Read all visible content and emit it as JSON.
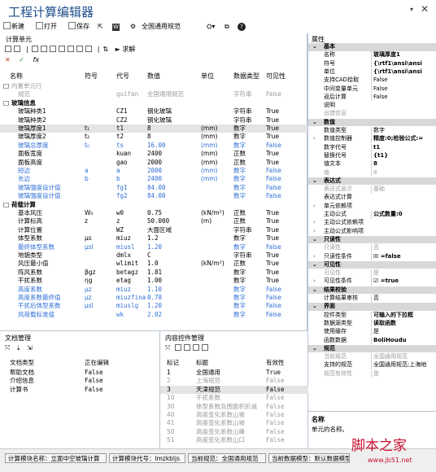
{
  "app": {
    "title": "工程计算编辑器",
    "pin": "▾",
    "close": "✕"
  },
  "toolbar": {
    "new": "新建",
    "open": "打开",
    "save": "保存",
    "word": "W",
    "code_label": "全国通用规范"
  },
  "left_panel": {
    "title": "计算单元",
    "solve": "求解",
    "icons": [
      "✕",
      "✓",
      "fx"
    ]
  },
  "table": {
    "headers": [
      "名称",
      "符号",
      "代号",
      "数值",
      "单位",
      "数据类型",
      "可见性"
    ],
    "rows": [
      {
        "indent": 1,
        "expand": "□",
        "name": "内置单元行",
        "sym": "",
        "code": "",
        "val": "",
        "unit": "",
        "type": "",
        "vis": "",
        "color": "gray"
      },
      {
        "indent": 2,
        "expand": "",
        "name": "规范",
        "sym": "",
        "code": "guifan",
        "val": "全国通用规范",
        "unit": "",
        "type": "字符串",
        "vis": "False",
        "color": "gray"
      },
      {
        "indent": 1,
        "expand": "□",
        "name": "玻璃信息",
        "sym": "",
        "code": "",
        "val": "",
        "unit": "",
        "type": "",
        "vis": "",
        "color": "",
        "group": true
      },
      {
        "indent": 2,
        "expand": "",
        "name": "玻璃种类1",
        "sym": "",
        "code": "CZ1",
        "val": "钢化玻璃",
        "unit": "",
        "type": "字符串",
        "vis": "True",
        "color": ""
      },
      {
        "indent": 2,
        "expand": "",
        "name": "玻璃种类2",
        "sym": "",
        "code": "CZ2",
        "val": "钢化玻璃",
        "unit": "",
        "type": "字符串",
        "vis": "True",
        "color": ""
      },
      {
        "indent": 2,
        "expand": "",
        "name": "玻璃厚度1",
        "sym": "t₁",
        "code": "t1",
        "val": "8",
        "unit": "(mm)",
        "type": "数字",
        "vis": "True",
        "color": "",
        "selected": true
      },
      {
        "indent": 2,
        "expand": "",
        "name": "玻璃厚度2",
        "sym": "t₂",
        "code": "t2",
        "val": "8",
        "unit": "(mm)",
        "type": "数字",
        "vis": "True",
        "color": ""
      },
      {
        "indent": 2,
        "expand": "",
        "name": "玻璃总厚度",
        "sym": "t₀",
        "code": "ts",
        "val": "16.00",
        "unit": "(mm)",
        "type": "数字",
        "vis": "False",
        "color": "blue"
      },
      {
        "indent": 2,
        "expand": "",
        "name": "面板宽度",
        "sym": "",
        "code": "kuan",
        "val": "2400",
        "unit": "(mm)",
        "type": "正数",
        "vis": "True",
        "color": ""
      },
      {
        "indent": 2,
        "expand": "",
        "name": "面板高度",
        "sym": "",
        "code": "gao",
        "val": "2000",
        "unit": "(mm)",
        "type": "正数",
        "vis": "True",
        "color": ""
      },
      {
        "indent": 2,
        "expand": "",
        "name": "短边",
        "sym": "a",
        "code": "a",
        "val": "2000",
        "unit": "(mm)",
        "type": "数字",
        "vis": "False",
        "color": "blue"
      },
      {
        "indent": 2,
        "expand": "",
        "name": "长边",
        "sym": "b",
        "code": "b",
        "val": "2400",
        "unit": "(mm)",
        "type": "数字",
        "vis": "False",
        "color": "blue"
      },
      {
        "indent": 2,
        "expand": "",
        "name": "玻璃强度设计值",
        "sym": "",
        "code": "fg1",
        "val": "84.00",
        "unit": "",
        "type": "数字",
        "vis": "False",
        "color": "blue"
      },
      {
        "indent": 2,
        "expand": "",
        "name": "玻璃强度设计值",
        "sym": "",
        "code": "fg2",
        "val": "84.00",
        "unit": "",
        "type": "数字",
        "vis": "False",
        "color": "blue"
      },
      {
        "indent": 1,
        "expand": "□",
        "name": "荷载计算",
        "sym": "",
        "code": "",
        "val": "",
        "unit": "",
        "type": "",
        "vis": "",
        "color": "",
        "group": true
      },
      {
        "indent": 2,
        "expand": "",
        "name": "基本风压",
        "sym": "W₀",
        "code": "w0",
        "val": "0.75",
        "unit": "(kN/m²)",
        "type": "正数",
        "vis": "True",
        "color": ""
      },
      {
        "indent": 2,
        "expand": "",
        "name": "计算标高",
        "sym": "z",
        "code": "z",
        "val": "50.000",
        "unit": "(m)",
        "type": "正数",
        "vis": "True",
        "color": ""
      },
      {
        "indent": 2,
        "expand": "",
        "name": "计算位置",
        "sym": "",
        "code": "WZ",
        "val": "大面区域",
        "unit": "",
        "type": "字符串",
        "vis": "True",
        "color": ""
      },
      {
        "indent": 2,
        "expand": "",
        "name": "体型系数",
        "sym": "μs",
        "code": "miuz",
        "val": "1.2",
        "unit": "",
        "type": "数字",
        "vis": "True",
        "color": ""
      },
      {
        "indent": 2,
        "expand": "",
        "name": "最终体型系数",
        "sym": "μsl",
        "code": "miusl",
        "val": "1.20",
        "unit": "",
        "type": "数字",
        "vis": "False",
        "color": "blue"
      },
      {
        "indent": 2,
        "expand": "",
        "name": "地貌类型",
        "sym": "",
        "code": "dmlx",
        "val": "C",
        "unit": "",
        "type": "字符串",
        "vis": "True",
        "color": ""
      },
      {
        "indent": 2,
        "expand": "",
        "name": "风压最小值",
        "sym": "",
        "code": "wlimit",
        "val": "1.0",
        "unit": "(kN/m²)",
        "type": "正数",
        "vis": "True",
        "color": ""
      },
      {
        "indent": 2,
        "expand": "",
        "name": "阵风系数",
        "sym": "βgz",
        "code": "betagz",
        "val": "1.81",
        "unit": "",
        "type": "数字",
        "vis": "True",
        "color": ""
      },
      {
        "indent": 2,
        "expand": "",
        "name": "干扰系数",
        "sym": "ηg",
        "code": "etag",
        "val": "1.00",
        "unit": "",
        "type": "数字",
        "vis": "True",
        "color": ""
      },
      {
        "indent": 2,
        "expand": "",
        "name": "高度系数",
        "sym": "μz",
        "code": "miuz",
        "val": "1.10",
        "unit": "",
        "type": "数字",
        "vis": "False",
        "color": "blue"
      },
      {
        "indent": 2,
        "expand": "",
        "name": "高度系数最终值",
        "sym": "μz",
        "code": "miuzfinal",
        "val": "0.78",
        "unit": "",
        "type": "数字",
        "vis": "False",
        "color": "blue"
      },
      {
        "indent": 2,
        "expand": "",
        "name": "干扰后体型系数",
        "sym": "μsl",
        "code": "miuslg",
        "val": "1.20",
        "unit": "",
        "type": "数字",
        "vis": "False",
        "color": "blue"
      },
      {
        "indent": 2,
        "expand": "",
        "name": "风荷载标准值",
        "sym": "",
        "code": "wk",
        "val": "2.02",
        "unit": "",
        "type": "数字",
        "vis": "False",
        "color": "blue"
      }
    ]
  },
  "properties": {
    "title": "属性",
    "rows": [
      {
        "kind": "cat",
        "name": "基本"
      },
      {
        "name": "名称",
        "value": "玻璃厚度1",
        "bold": true
      },
      {
        "name": "符号",
        "value": "{\\rtf1\\ansi\\ansi",
        "bold": true
      },
      {
        "name": "单位",
        "value": "{\\rtf1\\ansi\\ansi",
        "bold": true
      },
      {
        "name": "支持CAD拾取",
        "value": "False"
      },
      {
        "name": "中间变量单元",
        "value": "False"
      },
      {
        "name": "返后计算",
        "value": "False"
      },
      {
        "name": "说明",
        "value": ""
      },
      {
        "name": "出错信息",
        "value": "",
        "gray": true
      },
      {
        "kind": "cat",
        "name": "数值"
      },
      {
        "name": "数值类型",
        "value": "数字"
      },
      {
        "name": "数值控制器",
        "value": "精度:0;检验公式:=",
        "bold": true,
        "arrow": true
      },
      {
        "name": "数字代号",
        "value": "t1",
        "bold": true
      },
      {
        "name": "替换代号",
        "value": "{t1}",
        "bold": true
      },
      {
        "name": "值文本",
        "value": "8",
        "bold": true
      },
      {
        "name": "值",
        "value": "8",
        "gray": true
      },
      {
        "kind": "cat",
        "name": "表达式"
      },
      {
        "name": "表达式层次",
        "value": "基础",
        "gray": true
      },
      {
        "name": "表达式计算",
        "value": ""
      },
      {
        "name": "单元依赖项",
        "value": "",
        "arrow": true
      },
      {
        "name": "主动公式",
        "value": "公式数量:0",
        "bold": true
      },
      {
        "name": "主动公式依赖项",
        "value": "",
        "arrow": true
      },
      {
        "name": "主动公式影响项",
        "value": "",
        "arrow": true
      },
      {
        "kind": "cat",
        "name": "只读性"
      },
      {
        "name": "只读性",
        "value": "否",
        "gray": true
      },
      {
        "name": "只读性条件",
        "value": "☒ =false",
        "bold": true,
        "arrow": true
      },
      {
        "kind": "cat",
        "name": "可见性"
      },
      {
        "name": "可见性",
        "value": "是",
        "gray": true
      },
      {
        "name": "可见性条件",
        "value": "☑ =true",
        "bold": true,
        "arrow": true
      },
      {
        "kind": "cat",
        "name": "结果校验"
      },
      {
        "name": "计算结果审核",
        "value": "否"
      },
      {
        "kind": "cat",
        "name": "界面"
      },
      {
        "name": "控件类型",
        "value": "可输入的下拉框",
        "bold": true
      },
      {
        "name": "数据源类型",
        "value": "读取函数",
        "bold": true
      },
      {
        "name": "使用缓存",
        "value": "是"
      },
      {
        "name": "函数数据",
        "value": "BoliHoudu",
        "bold": true
      },
      {
        "kind": "cat",
        "name": "规范"
      },
      {
        "name": "当前规范",
        "value": "全国通用规范",
        "gray": true
      },
      {
        "name": "支持的规范",
        "value": "全国通用规范;上海地"
      },
      {
        "name": "规范有效性",
        "value": "是",
        "gray": true
      }
    ],
    "desc_title": "名称",
    "desc_text": "单元的名称。"
  },
  "doc_panel": {
    "title": "文档管理",
    "headers": [
      "文档类型",
      "正在编辑"
    ],
    "rows": [
      {
        "type": "帮助文档",
        "editing": "False"
      },
      {
        "type": "介绍信息",
        "editing": "False"
      },
      {
        "type": "计算书",
        "editing": "False"
      }
    ]
  },
  "ctrl_panel": {
    "title": "内容控件管理",
    "headers": [
      "标记",
      "标题",
      "有效性"
    ],
    "rows": [
      {
        "mark": "1",
        "title": "全国通用",
        "valid": "True",
        "gray": false
      },
      {
        "mark": "2",
        "title": "上海规范",
        "valid": "False",
        "gray": true
      },
      {
        "mark": "3",
        "title": "天津规范",
        "valid": "False",
        "gray": false,
        "selected": true
      },
      {
        "mark": "10",
        "title": "干扰系数",
        "valid": "False",
        "gray": true
      },
      {
        "mark": "30",
        "title": "体型系数及围面积折减",
        "valid": "False",
        "gray": true
      },
      {
        "mark": "40",
        "title": "高度变化系数山坡",
        "valid": "False",
        "gray": true
      },
      {
        "mark": "41",
        "title": "高度变化系数山坡",
        "valid": "False",
        "gray": true
      },
      {
        "mark": "50",
        "title": "高度变化系数山峰",
        "valid": "False",
        "gray": true
      },
      {
        "mark": "51",
        "title": "高度变化系数山口",
        "valid": "False",
        "gray": true
      }
    ]
  },
  "status": [
    "计算模块名称：立面中空玻璃计算",
    "计算模块代号：lmzkbljs",
    "当前规范：全国通用规范",
    "当前数据模型：默认数据模型"
  ],
  "watermark": {
    "brand": "脚本之家",
    "url": "www.jb51.net"
  }
}
